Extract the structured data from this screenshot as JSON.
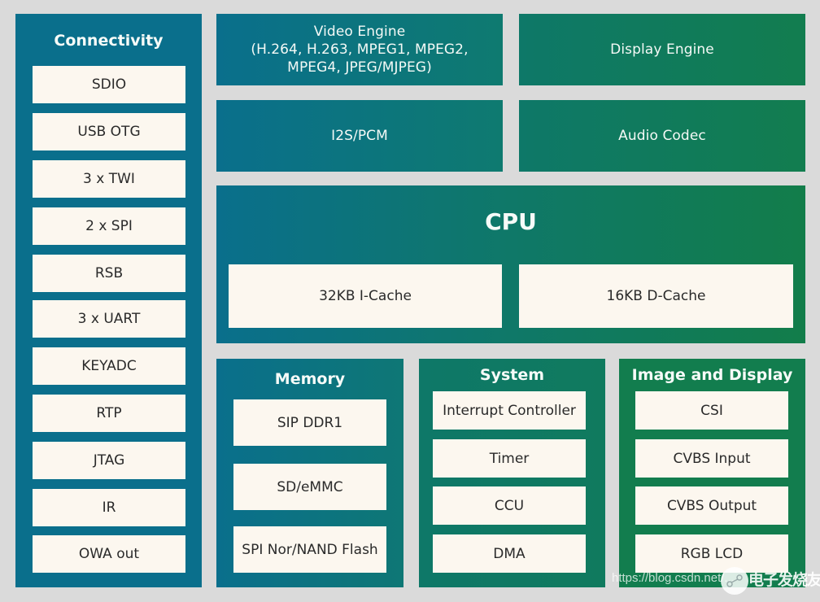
{
  "connectivity": {
    "title": "Connectivity",
    "items": [
      "SDIO",
      "USB OTG",
      "3 x TWI",
      "2 x SPI",
      "RSB",
      "3 x UART",
      "KEYADC",
      "RTP",
      "JTAG",
      "IR",
      "OWA out"
    ]
  },
  "video_engine": {
    "line1": "Video Engine",
    "line2": "(H.264, H.263, MPEG1, MPEG2,",
    "line3": "MPEG4, JPEG/MJPEG)"
  },
  "display_engine": {
    "label": "Display Engine"
  },
  "i2s_pcm": {
    "label": "I2S/PCM"
  },
  "audio_codec": {
    "label": "Audio Codec"
  },
  "cpu": {
    "title": "CPU",
    "icache": "32KB I-Cache",
    "dcache": "16KB D-Cache"
  },
  "memory": {
    "title": "Memory",
    "items": [
      "SIP DDR1",
      "SD/eMMC",
      "SPI Nor/NAND Flash"
    ]
  },
  "system": {
    "title": "System",
    "items": [
      "Interrupt Controller",
      "Timer",
      "CCU",
      "DMA"
    ]
  },
  "image_display": {
    "title": "Image and Display",
    "items": [
      "CSI",
      "CVBS Input",
      "CVBS Output",
      "RGB LCD"
    ]
  },
  "watermark": {
    "url": "https://blog.csdn.net/...",
    "brand": "电子发烧友",
    "logo_icon": "circuit-logo-icon"
  },
  "colors": {
    "background": "#dadada",
    "blue": "#0a6f8c",
    "green": "#127d4e",
    "cell": "#fcf7ef",
    "cell_text": "#2a2a2a"
  }
}
